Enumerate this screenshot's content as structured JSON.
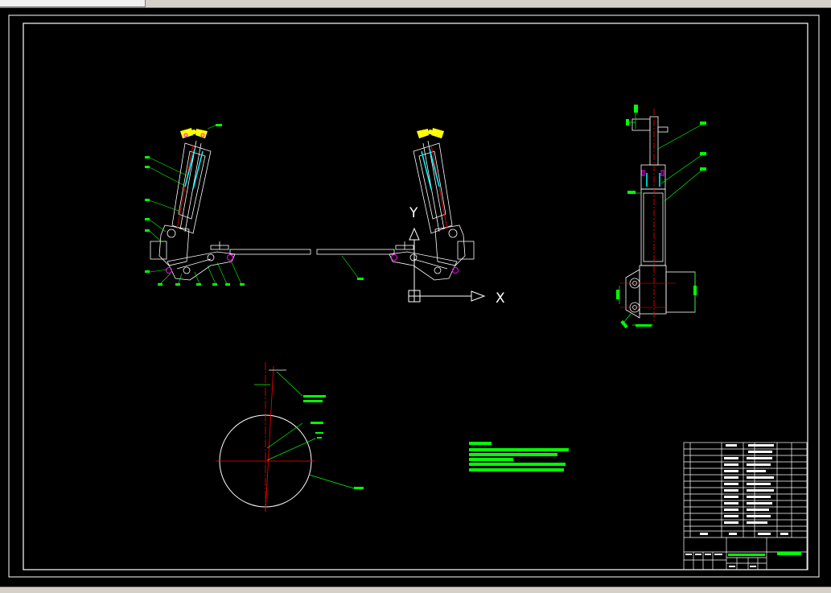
{
  "window": {
    "tab_title": ""
  },
  "axes_indicator": {
    "x_label": "X",
    "y_label": "Y"
  },
  "colors": {
    "background": "#000000",
    "frame": "#ffffff",
    "annotation": "#00ff00",
    "center_line": "#ff0000",
    "accent_cyan": "#00ffff",
    "accent_yellow": "#ffff00",
    "accent_magenta": "#ff00ff"
  },
  "icons": [
    "ucs-axis-icon",
    "crosshair-icon"
  ]
}
